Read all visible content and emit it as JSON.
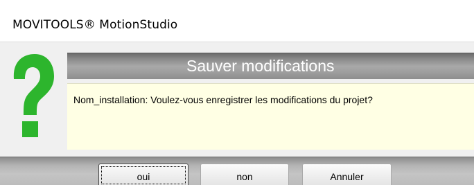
{
  "window": {
    "title": "MOVITOOLS® MotionStudio"
  },
  "dialog": {
    "header": "Sauver modifications",
    "message": "Nom_installation: Voulez-vous enregistrer les modifications du projet?",
    "icon": "question-mark-icon",
    "icon_color": "#2db52d"
  },
  "buttons": {
    "yes_label": "oui",
    "no_label": "non",
    "cancel_label": "Annuler"
  },
  "colors": {
    "message_background": "#ffffe4",
    "header_text": "#ffffff"
  }
}
